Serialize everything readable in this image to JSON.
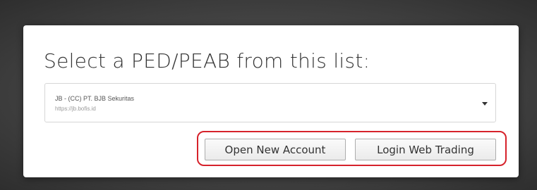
{
  "dialog": {
    "title": "Select a PED/PEAB from this list:",
    "select": {
      "selected_label": "JB - (CC) PT. BJB Sekuritas",
      "selected_url": "https://jb.bofis.id"
    },
    "buttons": {
      "open_account_label": "Open New Account",
      "login_label": "Login Web Trading"
    },
    "highlight_color": "#d6222b"
  }
}
